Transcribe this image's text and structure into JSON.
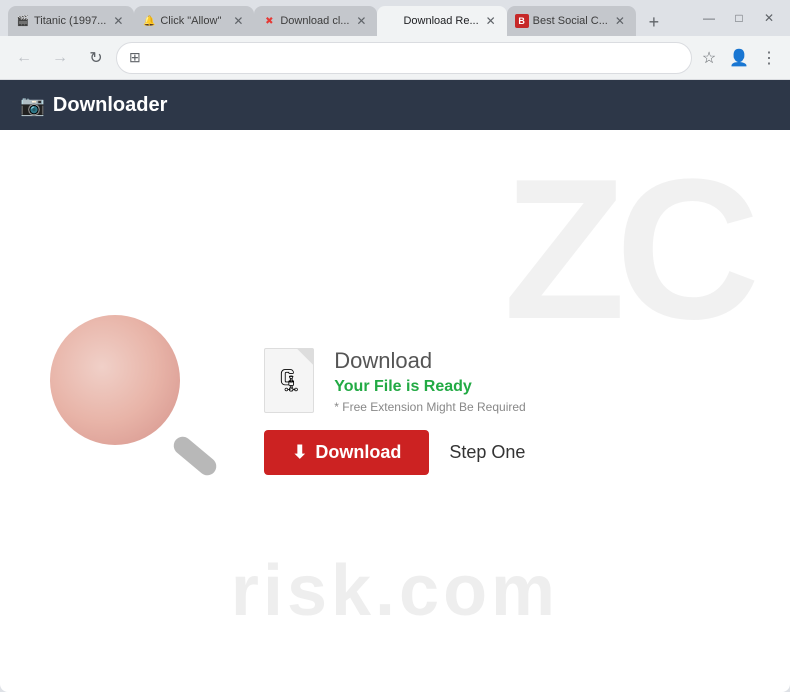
{
  "browser": {
    "tabs": [
      {
        "id": "tab1",
        "title": "Titanic (1997...",
        "favicon": "🎬",
        "active": false,
        "closeable": true
      },
      {
        "id": "tab2",
        "title": "Click \"Allow\"",
        "favicon": "🔔",
        "active": false,
        "closeable": true
      },
      {
        "id": "tab3",
        "title": "Download cl...",
        "favicon": "✖",
        "active": false,
        "closeable": true,
        "error": true
      },
      {
        "id": "tab4",
        "title": "Download Re...",
        "favicon": "",
        "active": true,
        "closeable": true
      },
      {
        "id": "tab5",
        "title": "Best Social C...",
        "favicon": "🅱",
        "active": false,
        "closeable": true
      }
    ],
    "new_tab_label": "+",
    "address": "",
    "address_placeholder": ""
  },
  "window_controls": {
    "minimize": "—",
    "maximize": "□",
    "close": "✕"
  },
  "toolbar": {
    "back": "←",
    "forward": "→",
    "refresh": "↻",
    "site_settings": "⊞"
  },
  "header": {
    "icon": "📷",
    "title": "Downloader"
  },
  "watermark": {
    "letters": "ZC",
    "text": "risk.com"
  },
  "download_card": {
    "title": "Download",
    "subtitle": "Your File is Ready",
    "note": "* Free Extension Might Be Required",
    "button_label": "Download",
    "button_icon": "⬇",
    "step_label": "Step One"
  }
}
